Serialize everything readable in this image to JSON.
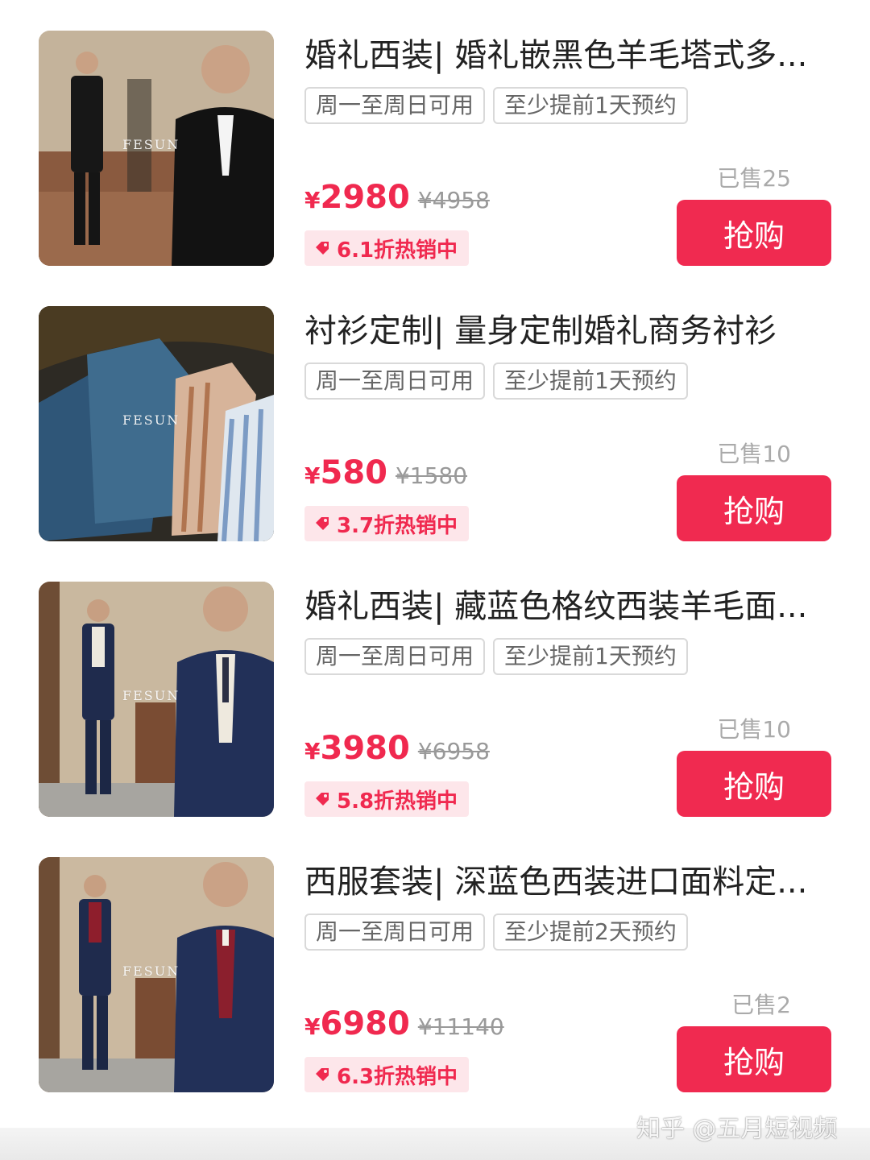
{
  "products": [
    {
      "title": "婚礼西装| 婚礼嵌黑色羊毛塔式多...",
      "tags": [
        "周一至周日可用",
        "至少提前1天预约"
      ],
      "currency": "¥",
      "price": "2980",
      "original_price": "¥4958",
      "discount": "6.1折热销中",
      "sold": "已售25",
      "buy_label": "抢购",
      "image_logo": "FESUN"
    },
    {
      "title": "衬衫定制| 量身定制婚礼商务衬衫",
      "tags": [
        "周一至周日可用",
        "至少提前1天预约"
      ],
      "currency": "¥",
      "price": "580",
      "original_price": "¥1580",
      "discount": "3.7折热销中",
      "sold": "已售10",
      "buy_label": "抢购",
      "image_logo": "FESUN"
    },
    {
      "title": "婚礼西装| 藏蓝色格纹西装羊毛面...",
      "tags": [
        "周一至周日可用",
        "至少提前1天预约"
      ],
      "currency": "¥",
      "price": "3980",
      "original_price": "¥6958",
      "discount": "5.8折热销中",
      "sold": "已售10",
      "buy_label": "抢购",
      "image_logo": "FESUN"
    },
    {
      "title": "西服套装| 深蓝色西装进口面料定...",
      "tags": [
        "周一至周日可用",
        "至少提前2天预约"
      ],
      "currency": "¥",
      "price": "6980",
      "original_price": "¥11140",
      "discount": "6.3折热销中",
      "sold": "已售2",
      "buy_label": "抢购",
      "image_logo": "FESUN"
    }
  ],
  "watermark": "知乎 @五月短视频",
  "colors": {
    "accent": "#f0294f",
    "button": "#f02a50",
    "discount_bg": "#fde6ea",
    "tag_border": "#d9d9d9"
  },
  "icons": {
    "discount": "price-tag-icon"
  }
}
